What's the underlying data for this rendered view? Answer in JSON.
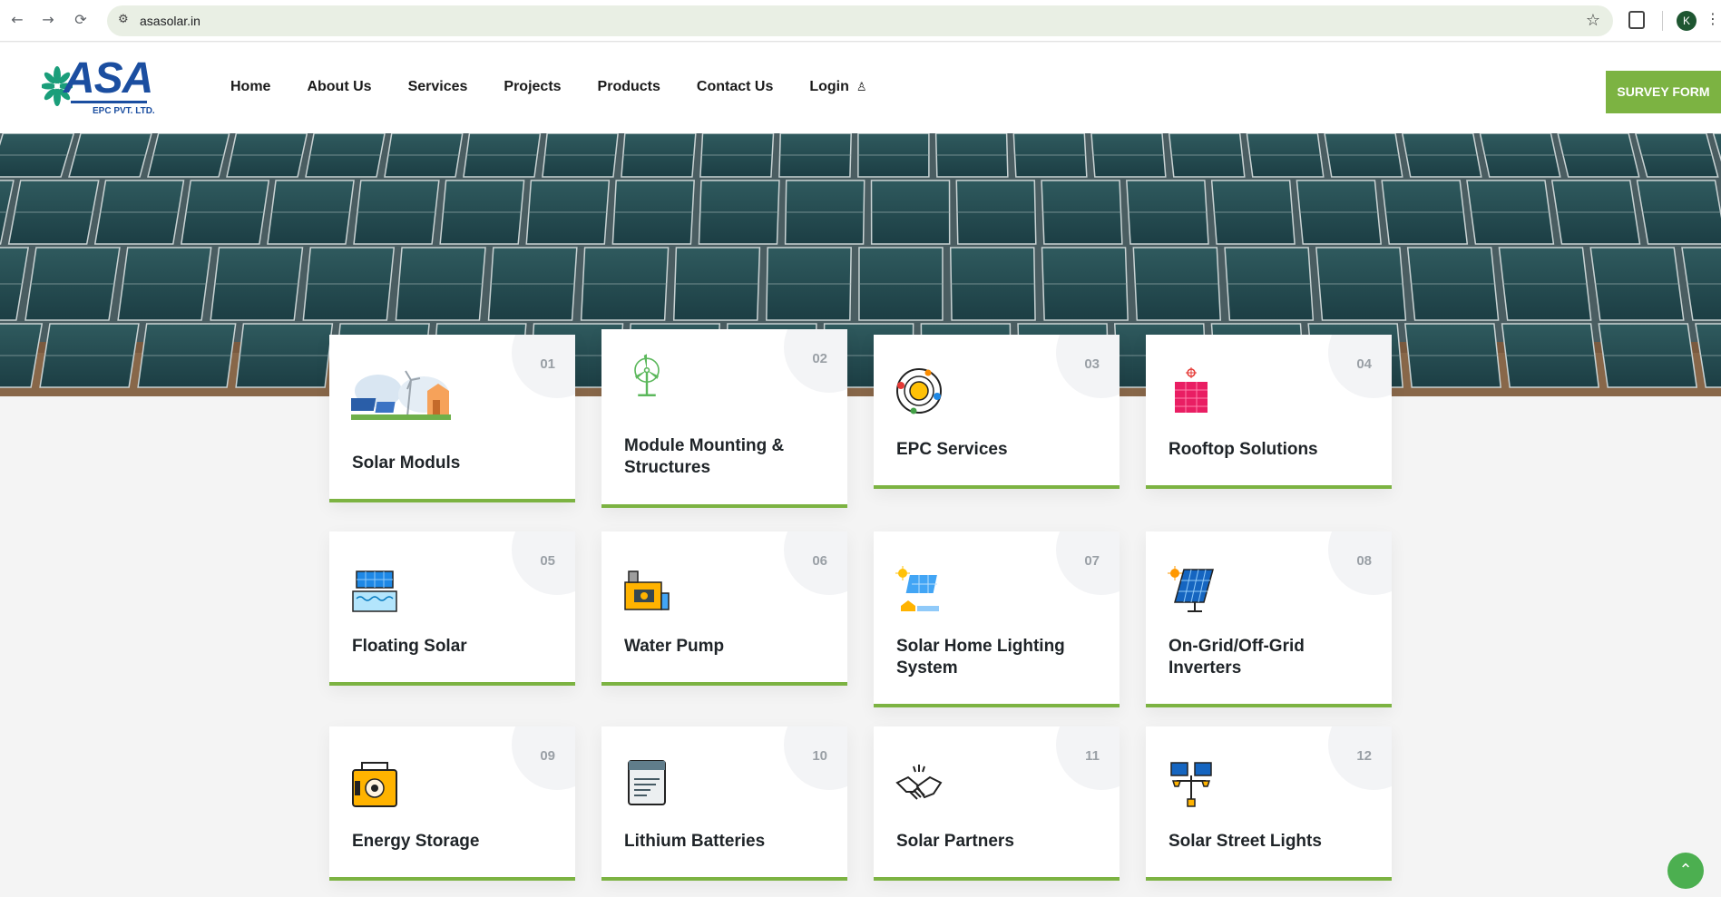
{
  "browser": {
    "url": "asasolar.in",
    "profile_initial": "K",
    "back_glyph": "←",
    "forward_glyph": "→",
    "reload_glyph": "⟳",
    "star_glyph": "☆",
    "menu_glyph": "⋮"
  },
  "logo": {
    "brand": "ASA",
    "sub": "EPC PVT. LTD."
  },
  "nav": {
    "items": [
      "Home",
      "About Us",
      "Services",
      "Projects",
      "Products",
      "Contact Us",
      "Login"
    ],
    "login_icon": "user-icon"
  },
  "survey_button": "SURVEY FORM",
  "colors": {
    "accent_green": "#7cb342",
    "brand_blue": "#1b4ea0",
    "fan_green": "#1a9e7a"
  },
  "cards": [
    {
      "num": "01",
      "title": "Solar Moduls",
      "icon": "solar-landscape-icon"
    },
    {
      "num": "02",
      "title": "Module Mounting & Structures",
      "icon": "wind-turbine-icon"
    },
    {
      "num": "03",
      "title": "EPC Services",
      "icon": "sun-orbit-icon"
    },
    {
      "num": "04",
      "title": "Rooftop Solutions",
      "icon": "rooftop-panel-icon"
    },
    {
      "num": "05",
      "title": "Floating Solar",
      "icon": "floating-solar-icon"
    },
    {
      "num": "06",
      "title": "Water Pump",
      "icon": "water-pump-icon"
    },
    {
      "num": "07",
      "title": "Solar Home Lighting System",
      "icon": "home-lighting-icon"
    },
    {
      "num": "08",
      "title": "On-Grid/Off-Grid Inverters",
      "icon": "solar-panel-sun-icon"
    },
    {
      "num": "09",
      "title": "Energy Storage",
      "icon": "battery-icon"
    },
    {
      "num": "10",
      "title": "Lithium Batteries",
      "icon": "lithium-battery-icon"
    },
    {
      "num": "11",
      "title": "Solar Partners",
      "icon": "handshake-icon"
    },
    {
      "num": "12",
      "title": "Solar Street Lights",
      "icon": "street-light-icon"
    }
  ],
  "scroll_top_icon": "chevron-up-icon"
}
